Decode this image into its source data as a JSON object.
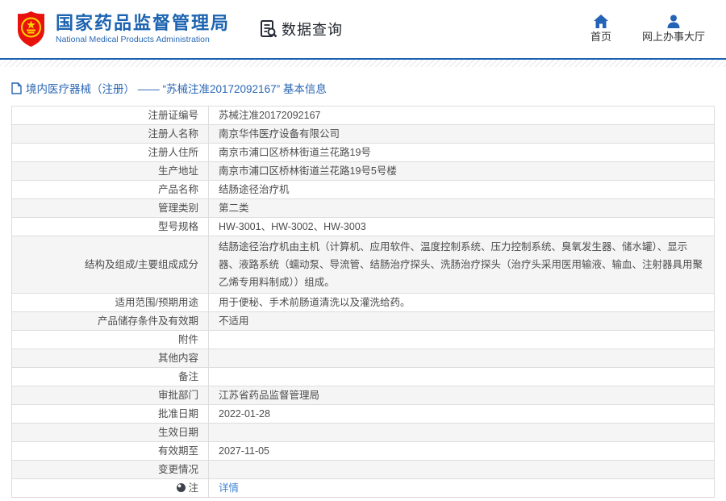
{
  "header": {
    "org_name_cn": "国家药品监督管理局",
    "org_name_en": "National Medical Products Administration",
    "section_title": "数据查询",
    "nav": [
      {
        "label": "首页",
        "icon": "home-icon"
      },
      {
        "label": "网上办事大厅",
        "icon": "person-icon"
      }
    ]
  },
  "icons": {
    "logo": "national-emblem-icon",
    "section": "document-search-icon",
    "breadcrumb": "document-icon",
    "note": "note-dot-icon"
  },
  "colors": {
    "brand_blue": "#1b63b0",
    "rule_blue": "#1a62af",
    "link_blue": "#3f85d6",
    "emblem_red": "#e8120c",
    "emblem_yellow": "#ffd500",
    "row_alt_gray": "#f5f5f5",
    "border_gray": "#dddddd"
  },
  "breadcrumb": {
    "text": "境内医疗器械（注册） —— “苏械注准20172092167” 基本信息"
  },
  "table": {
    "rows": [
      {
        "label": "注册证编号",
        "value": "苏械注准20172092167"
      },
      {
        "label": "注册人名称",
        "value": "南京华伟医疗设备有限公司"
      },
      {
        "label": "注册人住所",
        "value": "南京市浦口区桥林街道兰花路19号"
      },
      {
        "label": "生产地址",
        "value": "南京市浦口区桥林街道兰花路19号5号楼"
      },
      {
        "label": "产品名称",
        "value": "结肠途径治疗机"
      },
      {
        "label": "管理类别",
        "value": "第二类"
      },
      {
        "label": "型号规格",
        "value": "HW-3001、HW-3002、HW-3003"
      },
      {
        "label": "结构及组成/主要组成成分",
        "value": "结肠途径治疗机由主机（计算机、应用软件、温度控制系统、压力控制系统、臭氧发生器、储水罐）、显示器、液路系统（蠕动泵、导流管、结肠治疗探头、洗肠治疗探头（治疗头采用医用输液、输血、注射器具用聚乙烯专用料制成））组成。"
      },
      {
        "label": "适用范围/预期用途",
        "value": "用于便秘、手术前肠道清洗以及灌洗给药。"
      },
      {
        "label": "产品储存条件及有效期",
        "value": "不适用"
      },
      {
        "label": "附件",
        "value": ""
      },
      {
        "label": "其他内容",
        "value": ""
      },
      {
        "label": "备注",
        "value": ""
      },
      {
        "label": "审批部门",
        "value": "江苏省药品监督管理局"
      },
      {
        "label": "批准日期",
        "value": "2022-01-28"
      },
      {
        "label": "生效日期",
        "value": ""
      },
      {
        "label": "有效期至",
        "value": "2027-11-05"
      },
      {
        "label": "变更情况",
        "value": ""
      },
      {
        "label": "注",
        "link_text": "详情"
      }
    ]
  }
}
